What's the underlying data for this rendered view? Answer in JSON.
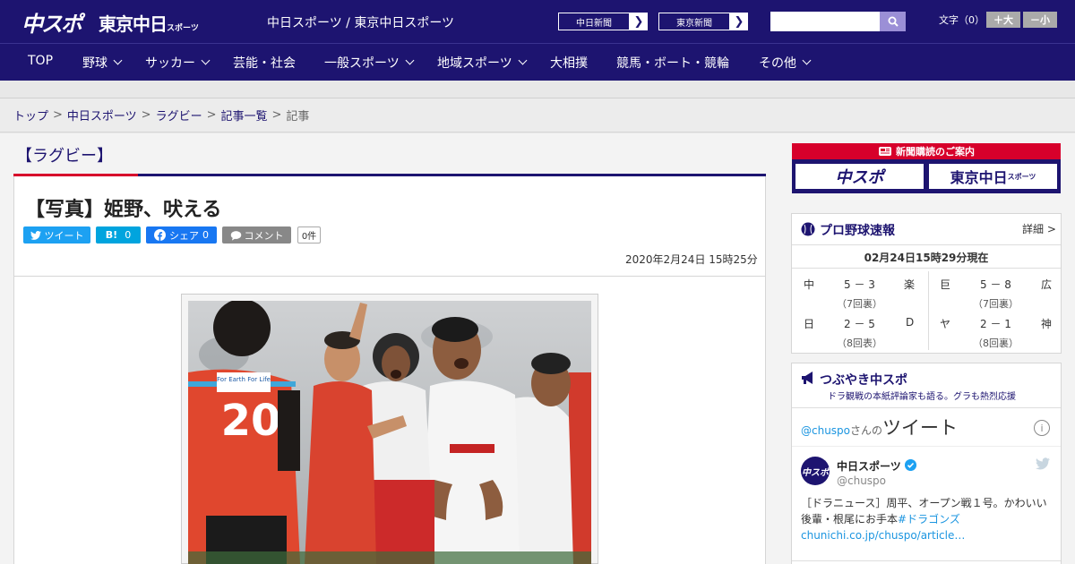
{
  "header": {
    "logo_main": "中スポ",
    "logo_sub": "東京中日",
    "logo_sub_small": "スポーツ",
    "site_name": "中日スポーツ / 東京中日スポーツ",
    "paper_links": [
      {
        "label": "中日新聞"
      },
      {
        "label": "東京新聞"
      }
    ],
    "search": {
      "value": "",
      "placeholder": ""
    },
    "font_size_label": "文字（0）",
    "font_larger": "＋大",
    "font_smaller": "－小"
  },
  "nav": {
    "items": [
      {
        "label": "TOP",
        "has_menu": false
      },
      {
        "label": "野球",
        "has_menu": true
      },
      {
        "label": "サッカー",
        "has_menu": true
      },
      {
        "label": "芸能・社会",
        "has_menu": false
      },
      {
        "label": "一般スポーツ",
        "has_menu": true
      },
      {
        "label": "地域スポーツ",
        "has_menu": true
      },
      {
        "label": "大相撲",
        "has_menu": false
      },
      {
        "label": "競馬・ボート・競輪",
        "has_menu": false
      },
      {
        "label": "その他",
        "has_menu": true
      }
    ]
  },
  "breadcrumb": {
    "items": [
      "トップ",
      "中日スポーツ",
      "ラグビー",
      "記事一覧"
    ],
    "current": "記事",
    "separator": ">"
  },
  "article": {
    "category": "【ラグビー】",
    "title": "【写真】姫野、吠える",
    "date": "2020年2月24日 15時25分",
    "share": {
      "twitter": "ツイート",
      "hatena_label": "B!",
      "hatena_count": "0",
      "facebook": "シェア",
      "facebook_count": "0",
      "comment": "コメント",
      "comment_count": "0件"
    },
    "photo": {
      "jersey_text": "For Earth For Life",
      "player_number": "20"
    }
  },
  "sidebar": {
    "subscription": {
      "header": "新聞購読のご案内",
      "logo_left": "中スポ",
      "logo_right": "東京中日",
      "logo_right_small": "スポーツ"
    },
    "baseball": {
      "title": "プロ野球速報",
      "detail": "詳細 >",
      "updated": "02月24日15時29分現在",
      "games": [
        {
          "home": "中",
          "score": "5 － 3",
          "away": "楽",
          "inning": "（7回裏）"
        },
        {
          "home": "巨",
          "score": "5 － 8",
          "away": "広",
          "inning": "（7回裏）"
        },
        {
          "home": "日",
          "score": "2 － 5",
          "away": "D",
          "inning": "（8回表）"
        },
        {
          "home": "ヤ",
          "score": "2 － 1",
          "away": "神",
          "inning": "（8回裏）"
        }
      ]
    },
    "twitter": {
      "title": "つぶやき中スポ",
      "subtitle": "ドラ観戦の本紙評論家も語る。グラも熱烈応援",
      "user_link": "@chuspo",
      "user_suffix": "さんの",
      "heading": "ツイート",
      "account_name": "中日スポーツ",
      "handle": "@chuspo",
      "avatar_text": "中スポ",
      "tweet_text": "［ドラニュース］周平、オープン戦１号。かわいい後輩・根尾にお手本",
      "tweet_hashtag": "#ドラゴンズ",
      "tweet_link": "chunichi.co.jp/chuspo/article…"
    }
  },
  "colors": {
    "brand_navy": "#1d1470",
    "accent_red": "#d7002b",
    "twitter_blue": "#1da1f2",
    "hatena_blue": "#00a4de",
    "facebook_blue": "#1877f2"
  }
}
